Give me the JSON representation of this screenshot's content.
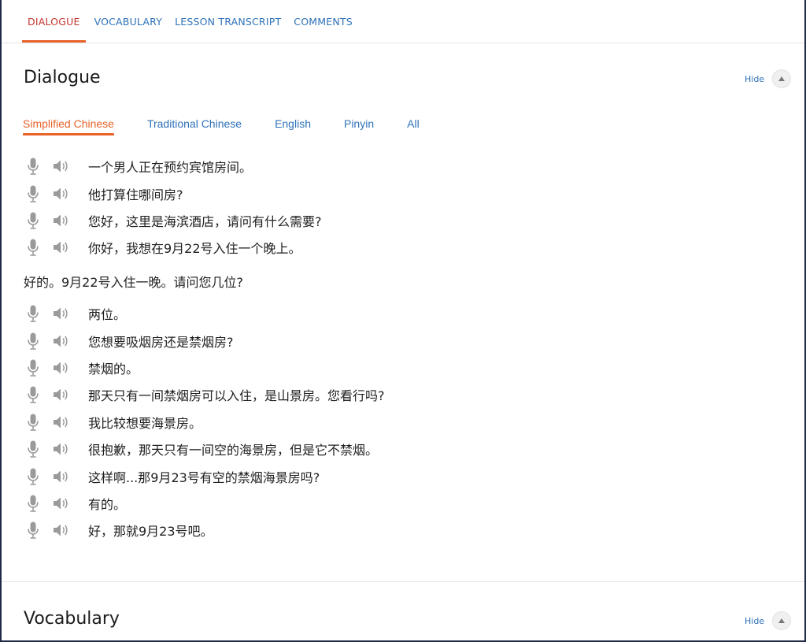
{
  "topnav": {
    "tabs": [
      {
        "label": "DIALOGUE",
        "active": true
      },
      {
        "label": "VOCABULARY",
        "active": false
      },
      {
        "label": "LESSON TRANSCRIPT",
        "active": false
      },
      {
        "label": "COMMENTS",
        "active": false
      }
    ]
  },
  "dialogue": {
    "title": "Dialogue",
    "hide_label": "Hide",
    "language_tabs": [
      {
        "label": "Simplified Chinese",
        "active": true
      },
      {
        "label": "Traditional Chinese",
        "active": false
      },
      {
        "label": "English",
        "active": false
      },
      {
        "label": "Pinyin",
        "active": false
      },
      {
        "label": "All",
        "active": false
      }
    ],
    "lines_top": [
      "一个男人正在预约宾馆房间。",
      "他打算住哪间房?",
      "您好，这里是海滨酒店，请问有什么需要?",
      "你好，我想在9月22号入住一个晚上。"
    ],
    "plain_line": "好的。9月22号入住一晚。请问您几位?",
    "lines_bottom": [
      "两位。",
      "您想要吸烟房还是禁烟房?",
      "禁烟的。",
      "那天只有一间禁烟房可以入住，是山景房。您看行吗?",
      "我比较想要海景房。",
      "很抱歉，那天只有一间空的海景房，但是它不禁烟。",
      "这样啊...那9月23号有空的禁烟海景房吗?",
      "有的。",
      "好，那就9月23号吧。"
    ]
  },
  "vocabulary": {
    "title": "Vocabulary",
    "hide_label": "Hide"
  },
  "colors": {
    "link": "#2f72b8",
    "active_tab": "#c2362f",
    "accent": "#e8632a"
  }
}
